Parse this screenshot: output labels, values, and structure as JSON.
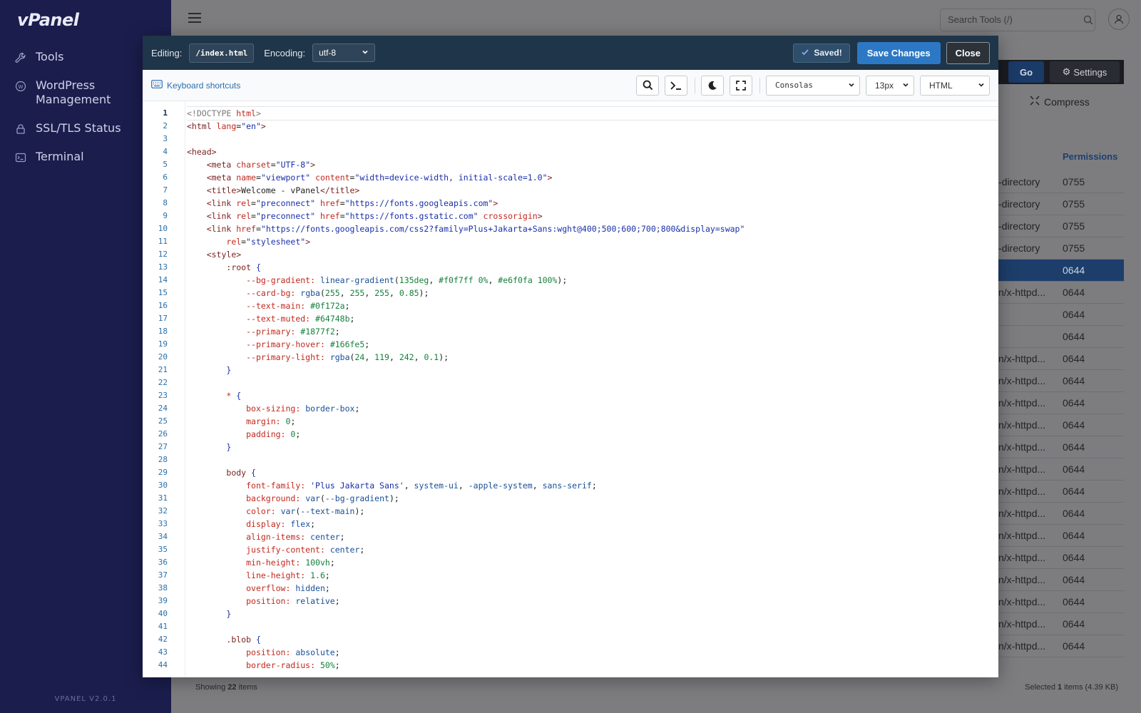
{
  "sidebar": {
    "logo": "vPanel",
    "items": [
      {
        "label": "Tools",
        "icon": "wrench-icon"
      },
      {
        "label": "WordPress\nManagement",
        "icon": "wordpress-icon"
      },
      {
        "label": "SSL/TLS Status",
        "icon": "lock-icon"
      },
      {
        "label": "Terminal",
        "icon": "terminal-icon"
      }
    ],
    "version": "VPANEL V2.0.1"
  },
  "topbar": {
    "search_placeholder": "Search Tools (/)"
  },
  "background": {
    "go_label": "Go",
    "settings_label": "Settings",
    "compress_label": "Compress",
    "permissions_header": "Permissions",
    "rows": [
      {
        "type": "-directory",
        "perm": "0755",
        "selected": false
      },
      {
        "type": "-directory",
        "perm": "0755",
        "selected": false
      },
      {
        "type": "-directory",
        "perm": "0755",
        "selected": false
      },
      {
        "type": "-directory",
        "perm": "0755",
        "selected": false
      },
      {
        "type": "",
        "perm": "0644",
        "selected": true
      },
      {
        "type": "n/x-httpd...",
        "perm": "0644",
        "selected": false
      },
      {
        "type": "",
        "perm": "0644",
        "selected": false
      },
      {
        "type": "",
        "perm": "0644",
        "selected": false
      },
      {
        "type": "n/x-httpd...",
        "perm": "0644",
        "selected": false
      },
      {
        "type": "n/x-httpd...",
        "perm": "0644",
        "selected": false
      },
      {
        "type": "n/x-httpd...",
        "perm": "0644",
        "selected": false
      },
      {
        "type": "n/x-httpd...",
        "perm": "0644",
        "selected": false
      },
      {
        "type": "n/x-httpd...",
        "perm": "0644",
        "selected": false
      },
      {
        "type": "n/x-httpd...",
        "perm": "0644",
        "selected": false
      },
      {
        "type": "n/x-httpd...",
        "perm": "0644",
        "selected": false
      },
      {
        "type": "n/x-httpd...",
        "perm": "0644",
        "selected": false
      },
      {
        "type": "n/x-httpd...",
        "perm": "0644",
        "selected": false
      },
      {
        "type": "n/x-httpd...",
        "perm": "0644",
        "selected": false
      },
      {
        "type": "n/x-httpd...",
        "perm": "0644",
        "selected": false
      },
      {
        "type": "n/x-httpd...",
        "perm": "0644",
        "selected": false
      },
      {
        "type": "n/x-httpd...",
        "perm": "0644",
        "selected": false
      },
      {
        "type": "n/x-httpd...",
        "perm": "0644",
        "selected": false
      }
    ],
    "footer_showing_prefix": "Showing ",
    "footer_count": "22",
    "footer_showing_suffix": " items",
    "footer_selected_prefix": "Selected ",
    "footer_selected_count": "1",
    "footer_selected_suffix": " items (4.39 KB)"
  },
  "modal": {
    "editing_label": "Editing:",
    "file_name": "/index.html",
    "encoding_label": "Encoding:",
    "encoding_value": "utf-8",
    "saved_label": "Saved!",
    "save_label": "Save Changes",
    "close_label": "Close",
    "keyboard_shortcuts": "Keyboard shortcuts",
    "font_value": "Consolas",
    "size_value": "13px",
    "mode_value": "HTML",
    "active_line": 1,
    "code_lines": [
      [
        [
          "c",
          "<!DOCTYPE "
        ],
        [
          "a",
          "html"
        ],
        [
          "c",
          ">"
        ]
      ],
      [
        [
          "t",
          "<html "
        ],
        [
          "a",
          "lang"
        ],
        [
          "x",
          "="
        ],
        [
          "s",
          "\"en\""
        ],
        [
          "t",
          ">"
        ]
      ],
      [],
      [
        [
          "t",
          "<head>"
        ]
      ],
      [
        [
          "x",
          "    "
        ],
        [
          "t",
          "<meta "
        ],
        [
          "a",
          "charset"
        ],
        [
          "x",
          "="
        ],
        [
          "s",
          "\"UTF-8\""
        ],
        [
          "t",
          ">"
        ]
      ],
      [
        [
          "x",
          "    "
        ],
        [
          "t",
          "<meta "
        ],
        [
          "a",
          "name"
        ],
        [
          "x",
          "="
        ],
        [
          "s",
          "\"viewport\""
        ],
        [
          "x",
          " "
        ],
        [
          "a",
          "content"
        ],
        [
          "x",
          "="
        ],
        [
          "s",
          "\"width=device-width, initial-scale=1.0\""
        ],
        [
          "t",
          ">"
        ]
      ],
      [
        [
          "x",
          "    "
        ],
        [
          "t",
          "<title>"
        ],
        [
          "x",
          "Welcome - vPanel"
        ],
        [
          "t",
          "</title>"
        ]
      ],
      [
        [
          "x",
          "    "
        ],
        [
          "t",
          "<link "
        ],
        [
          "a",
          "rel"
        ],
        [
          "x",
          "="
        ],
        [
          "s",
          "\"preconnect\""
        ],
        [
          "x",
          " "
        ],
        [
          "a",
          "href"
        ],
        [
          "x",
          "="
        ],
        [
          "s",
          "\"https://fonts.googleapis.com\""
        ],
        [
          "t",
          ">"
        ]
      ],
      [
        [
          "x",
          "    "
        ],
        [
          "t",
          "<link "
        ],
        [
          "a",
          "rel"
        ],
        [
          "x",
          "="
        ],
        [
          "s",
          "\"preconnect\""
        ],
        [
          "x",
          " "
        ],
        [
          "a",
          "href"
        ],
        [
          "x",
          "="
        ],
        [
          "s",
          "\"https://fonts.gstatic.com\""
        ],
        [
          "x",
          " "
        ],
        [
          "a",
          "crossorigin"
        ],
        [
          "t",
          ">"
        ]
      ],
      [
        [
          "x",
          "    "
        ],
        [
          "t",
          "<link "
        ],
        [
          "a",
          "href"
        ],
        [
          "x",
          "="
        ],
        [
          "s",
          "\"https://fonts.googleapis.com/css2?family=Plus+Jakarta+Sans:wght@400;500;600;700;800&display=swap\""
        ]
      ],
      [
        [
          "x",
          "        "
        ],
        [
          "a",
          "rel"
        ],
        [
          "x",
          "="
        ],
        [
          "s",
          "\"stylesheet\""
        ],
        [
          "t",
          ">"
        ]
      ],
      [
        [
          "x",
          "    "
        ],
        [
          "t",
          "<style>"
        ]
      ],
      [
        [
          "x",
          "        "
        ],
        [
          "t",
          ":root "
        ],
        [
          "b",
          "{"
        ]
      ],
      [
        [
          "x",
          "            "
        ],
        [
          "p",
          "--bg-gradient:"
        ],
        [
          "x",
          " "
        ],
        [
          "v",
          "linear-gradient"
        ],
        [
          "x",
          "("
        ],
        [
          "n",
          "135deg"
        ],
        [
          "x",
          ", "
        ],
        [
          "n",
          "#f0f7ff"
        ],
        [
          "x",
          " "
        ],
        [
          "n",
          "0%"
        ],
        [
          "x",
          ", "
        ],
        [
          "n",
          "#e6f0fa"
        ],
        [
          "x",
          " "
        ],
        [
          "n",
          "100%"
        ],
        [
          "x",
          ");"
        ]
      ],
      [
        [
          "x",
          "            "
        ],
        [
          "p",
          "--card-bg:"
        ],
        [
          "x",
          " "
        ],
        [
          "v",
          "rgba"
        ],
        [
          "x",
          "("
        ],
        [
          "n",
          "255"
        ],
        [
          "x",
          ", "
        ],
        [
          "n",
          "255"
        ],
        [
          "x",
          ", "
        ],
        [
          "n",
          "255"
        ],
        [
          "x",
          ", "
        ],
        [
          "n",
          "0.85"
        ],
        [
          "x",
          ");"
        ]
      ],
      [
        [
          "x",
          "            "
        ],
        [
          "p",
          "--text-main:"
        ],
        [
          "x",
          " "
        ],
        [
          "n",
          "#0f172a"
        ],
        [
          "x",
          ";"
        ]
      ],
      [
        [
          "x",
          "            "
        ],
        [
          "p",
          "--text-muted:"
        ],
        [
          "x",
          " "
        ],
        [
          "n",
          "#64748b"
        ],
        [
          "x",
          ";"
        ]
      ],
      [
        [
          "x",
          "            "
        ],
        [
          "p",
          "--primary:"
        ],
        [
          "x",
          " "
        ],
        [
          "n",
          "#1877f2"
        ],
        [
          "x",
          ";"
        ]
      ],
      [
        [
          "x",
          "            "
        ],
        [
          "p",
          "--primary-hover:"
        ],
        [
          "x",
          " "
        ],
        [
          "n",
          "#166fe5"
        ],
        [
          "x",
          ";"
        ]
      ],
      [
        [
          "x",
          "            "
        ],
        [
          "p",
          "--primary-light:"
        ],
        [
          "x",
          " "
        ],
        [
          "v",
          "rgba"
        ],
        [
          "x",
          "("
        ],
        [
          "n",
          "24"
        ],
        [
          "x",
          ", "
        ],
        [
          "n",
          "119"
        ],
        [
          "x",
          ", "
        ],
        [
          "n",
          "242"
        ],
        [
          "x",
          ", "
        ],
        [
          "n",
          "0.1"
        ],
        [
          "x",
          ");"
        ]
      ],
      [
        [
          "x",
          "        "
        ],
        [
          "b",
          "}"
        ]
      ],
      [],
      [
        [
          "x",
          "        "
        ],
        [
          "a",
          "* "
        ],
        [
          "b",
          "{"
        ]
      ],
      [
        [
          "x",
          "            "
        ],
        [
          "p",
          "box-sizing:"
        ],
        [
          "x",
          " "
        ],
        [
          "v",
          "border-box"
        ],
        [
          "x",
          ";"
        ]
      ],
      [
        [
          "x",
          "            "
        ],
        [
          "p",
          "margin:"
        ],
        [
          "x",
          " "
        ],
        [
          "n",
          "0"
        ],
        [
          "x",
          ";"
        ]
      ],
      [
        [
          "x",
          "            "
        ],
        [
          "p",
          "padding:"
        ],
        [
          "x",
          " "
        ],
        [
          "n",
          "0"
        ],
        [
          "x",
          ";"
        ]
      ],
      [
        [
          "x",
          "        "
        ],
        [
          "b",
          "}"
        ]
      ],
      [],
      [
        [
          "x",
          "        "
        ],
        [
          "t",
          "body "
        ],
        [
          "b",
          "{"
        ]
      ],
      [
        [
          "x",
          "            "
        ],
        [
          "p",
          "font-family:"
        ],
        [
          "x",
          " "
        ],
        [
          "s",
          "'Plus Jakarta Sans'"
        ],
        [
          "x",
          ", "
        ],
        [
          "v",
          "system-ui"
        ],
        [
          "x",
          ", "
        ],
        [
          "v",
          "-apple-system"
        ],
        [
          "x",
          ", "
        ],
        [
          "v",
          "sans-serif"
        ],
        [
          "x",
          ";"
        ]
      ],
      [
        [
          "x",
          "            "
        ],
        [
          "p",
          "background:"
        ],
        [
          "x",
          " "
        ],
        [
          "v",
          "var"
        ],
        [
          "x",
          "("
        ],
        [
          "v",
          "--bg-gradient"
        ],
        [
          "x",
          ");"
        ]
      ],
      [
        [
          "x",
          "            "
        ],
        [
          "p",
          "color:"
        ],
        [
          "x",
          " "
        ],
        [
          "v",
          "var"
        ],
        [
          "x",
          "("
        ],
        [
          "v",
          "--text-main"
        ],
        [
          "x",
          ");"
        ]
      ],
      [
        [
          "x",
          "            "
        ],
        [
          "p",
          "display:"
        ],
        [
          "x",
          " "
        ],
        [
          "v",
          "flex"
        ],
        [
          "x",
          ";"
        ]
      ],
      [
        [
          "x",
          "            "
        ],
        [
          "p",
          "align-items:"
        ],
        [
          "x",
          " "
        ],
        [
          "v",
          "center"
        ],
        [
          "x",
          ";"
        ]
      ],
      [
        [
          "x",
          "            "
        ],
        [
          "p",
          "justify-content:"
        ],
        [
          "x",
          " "
        ],
        [
          "v",
          "center"
        ],
        [
          "x",
          ";"
        ]
      ],
      [
        [
          "x",
          "            "
        ],
        [
          "p",
          "min-height:"
        ],
        [
          "x",
          " "
        ],
        [
          "n",
          "100vh"
        ],
        [
          "x",
          ";"
        ]
      ],
      [
        [
          "x",
          "            "
        ],
        [
          "p",
          "line-height:"
        ],
        [
          "x",
          " "
        ],
        [
          "n",
          "1.6"
        ],
        [
          "x",
          ";"
        ]
      ],
      [
        [
          "x",
          "            "
        ],
        [
          "p",
          "overflow:"
        ],
        [
          "x",
          " "
        ],
        [
          "v",
          "hidden"
        ],
        [
          "x",
          ";"
        ]
      ],
      [
        [
          "x",
          "            "
        ],
        [
          "p",
          "position:"
        ],
        [
          "x",
          " "
        ],
        [
          "v",
          "relative"
        ],
        [
          "x",
          ";"
        ]
      ],
      [
        [
          "x",
          "        "
        ],
        [
          "b",
          "}"
        ]
      ],
      [],
      [
        [
          "x",
          "        "
        ],
        [
          "t",
          ".blob "
        ],
        [
          "b",
          "{"
        ]
      ],
      [
        [
          "x",
          "            "
        ],
        [
          "p",
          "position:"
        ],
        [
          "x",
          " "
        ],
        [
          "v",
          "absolute"
        ],
        [
          "x",
          ";"
        ]
      ],
      [
        [
          "x",
          "            "
        ],
        [
          "p",
          "border-radius:"
        ],
        [
          "x",
          " "
        ],
        [
          "n",
          "50%"
        ],
        [
          "x",
          ";"
        ]
      ]
    ]
  }
}
